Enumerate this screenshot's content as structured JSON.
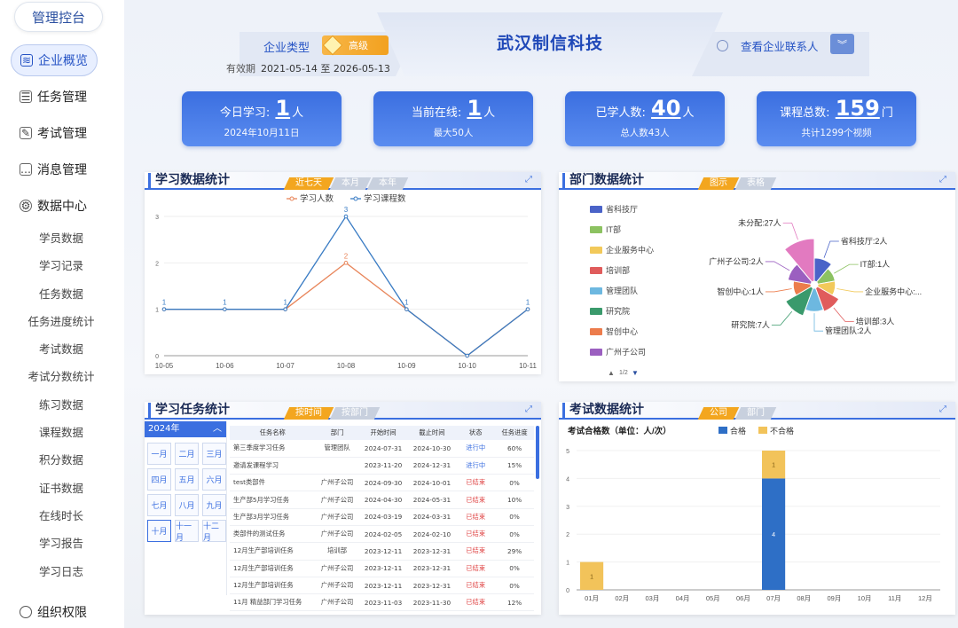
{
  "sidebar": {
    "logo": "管理控台",
    "main_items": [
      {
        "label": "企业概览",
        "icon": "layers-icon",
        "active": true
      },
      {
        "label": "任务管理",
        "icon": "task-icon",
        "active": false
      },
      {
        "label": "考试管理",
        "icon": "exam-icon",
        "active": false
      },
      {
        "label": "消息管理",
        "icon": "message-icon",
        "active": false
      },
      {
        "label": "数据中心",
        "icon": "gear-icon",
        "active": false
      }
    ],
    "sub_items": [
      "学员数据",
      "学习记录",
      "任务数据",
      "任务进度统计",
      "考试数据",
      "考试分数统计",
      "练习数据",
      "课程数据",
      "积分数据",
      "证书数据",
      "在线时长",
      "学习报告",
      "学习日志"
    ],
    "bottom_item": "组织权限"
  },
  "header": {
    "enterprise_type_label": "企业类型",
    "enterprise_level": "高级",
    "validity_label": "有效期",
    "validity_value": "2021-05-14 至 2026-05-13",
    "company_name": "武汉制信科技",
    "contact_label": "查看企业联系人"
  },
  "stats": [
    {
      "label": "今日学习:",
      "value": "1",
      "unit": "人",
      "sub": "2024年10月11日"
    },
    {
      "label": "当前在线:",
      "value": "1",
      "unit": "人",
      "sub": "最大50人"
    },
    {
      "label": "已学人数:",
      "value": "40",
      "unit": "人",
      "sub": "总人数43人"
    },
    {
      "label": "课程总数:",
      "value": "159",
      "unit": "门",
      "sub": "共计1299个视频"
    }
  ],
  "study_panel": {
    "title": "学习数据统计",
    "tabs": [
      "近七天",
      "本月",
      "本年"
    ],
    "active_tab": 0
  },
  "dept_panel": {
    "title": "部门数据统计",
    "tabs": [
      "图示",
      "表格"
    ],
    "active_tab": 0,
    "legend_pager": "1/2"
  },
  "task_panel": {
    "title": "学习任务统计",
    "tabs": [
      "按时间",
      "按部门"
    ],
    "active_tab": 0,
    "calendar_year": "2024年",
    "months": [
      "一月",
      "二月",
      "三月",
      "四月",
      "五月",
      "六月",
      "七月",
      "八月",
      "九月",
      "十月",
      "十一月",
      "十二月"
    ],
    "selected_month": 9,
    "columns": [
      "任务名称",
      "部门",
      "开始时间",
      "截止时间",
      "状态",
      "任务进度"
    ],
    "rows": [
      [
        "第三季度学习任务",
        "管理团队",
        "2024-07-31",
        "2024-10-30",
        "进行中",
        "60%"
      ],
      [
        "邀请发课程学习",
        "",
        "2023-11-20",
        "2024-12-31",
        "进行中",
        "15%"
      ],
      [
        "test类部件",
        "广州子公司",
        "2024-09-30",
        "2024-10-01",
        "已结束",
        "0%"
      ],
      [
        "生产部5月学习任务",
        "广州子公司",
        "2024-04-30",
        "2024-05-31",
        "已结束",
        "10%"
      ],
      [
        "生产部3月学习任务",
        "广州子公司",
        "2024-03-19",
        "2024-03-31",
        "已结束",
        "0%"
      ],
      [
        "类部件的测试任务",
        "广州子公司",
        "2024-02-05",
        "2024-02-10",
        "已结束",
        "0%"
      ],
      [
        "12月生产部培训任务",
        "培训部",
        "2023-12-11",
        "2023-12-31",
        "已结束",
        "29%"
      ],
      [
        "12月生产部培训任务",
        "广州子公司",
        "2023-12-11",
        "2023-12-31",
        "已结束",
        "0%"
      ],
      [
        "12月生产部培训任务",
        "广州子公司",
        "2023-12-11",
        "2023-12-31",
        "已结束",
        "0%"
      ],
      [
        "11月 精益部门学习任务",
        "广州子公司",
        "2023-11-03",
        "2023-11-30",
        "已结束",
        "12%"
      ]
    ]
  },
  "exam_panel": {
    "title": "考试数据统计",
    "tabs": [
      "公司",
      "部门"
    ],
    "active_tab": 0
  },
  "colors": {
    "accent": "#3b6fe0",
    "orange": "#f3a61f",
    "line_study": "#e8855a",
    "line_course": "#3a7cc4"
  },
  "chart_data": [
    {
      "type": "line",
      "x": [
        "10-05",
        "10-06",
        "10-07",
        "10-08",
        "10-09",
        "10-10",
        "10-11"
      ],
      "series": [
        {
          "name": "学习人数",
          "values": [
            1,
            1,
            1,
            2,
            1,
            0,
            1
          ],
          "color": "#e8855a"
        },
        {
          "name": "学习课程数",
          "values": [
            1,
            1,
            1,
            3,
            1,
            0,
            1
          ],
          "color": "#3a7cc4"
        }
      ],
      "ylim": [
        0,
        3
      ],
      "yticks": [
        "0",
        "1",
        "2",
        "3"
      ],
      "point_labels": [
        {
          "series": 0,
          "index": 3,
          "text": "2"
        },
        {
          "series": 1,
          "index": 0,
          "text": "1"
        },
        {
          "series": 1,
          "index": 1,
          "text": "1"
        },
        {
          "series": 1,
          "index": 2,
          "text": "1"
        },
        {
          "series": 1,
          "index": 3,
          "text": "3"
        },
        {
          "series": 1,
          "index": 4,
          "text": "1"
        },
        {
          "series": 1,
          "index": 6,
          "text": "1"
        }
      ],
      "legend_position": "top"
    },
    {
      "type": "pie",
      "rose": true,
      "slices": [
        {
          "name": "省科技厅",
          "label": "省科技厅:2人",
          "value": 2,
          "color": "#4a63c8"
        },
        {
          "name": "IT部",
          "label": "IT部:1人",
          "value": 1,
          "color": "#8cc261"
        },
        {
          "name": "企业服务中心",
          "label": "企业服务中心:...",
          "value": 1,
          "color": "#f2c95a"
        },
        {
          "name": "培训部",
          "label": "培训部:3人",
          "value": 3,
          "color": "#e05c5c"
        },
        {
          "name": "管理团队",
          "label": "管理团队:2人",
          "value": 2,
          "color": "#6db8e0"
        },
        {
          "name": "研究院",
          "label": "研究院:7人",
          "value": 7,
          "color": "#3a9a6c"
        },
        {
          "name": "智创中心",
          "label": "智创中心:1人",
          "value": 1,
          "color": "#ec7c4c"
        },
        {
          "name": "广州子公司",
          "label": "广州子公司:2人",
          "value": 2,
          "color": "#9b5fc0"
        },
        {
          "name": "未分配",
          "label": "未分配:27人",
          "value": 27,
          "color": "#e27ac0"
        }
      ],
      "legend_visible": [
        "省科技厅",
        "IT部",
        "企业服务中心",
        "培训部",
        "管理团队",
        "研究院",
        "智创中心",
        "广州子公司"
      ],
      "legend_position": "left"
    },
    {
      "type": "bar",
      "stacked": true,
      "title": "考试合格数（单位：人/次）",
      "categories": [
        "01月",
        "02月",
        "03月",
        "04月",
        "05月",
        "06月",
        "07月",
        "08月",
        "09月",
        "10月",
        "11月",
        "12月"
      ],
      "series": [
        {
          "name": "合格",
          "values": [
            0,
            0,
            0,
            0,
            0,
            0,
            4,
            0,
            0,
            0,
            0,
            0
          ],
          "color": "#2e6fc6"
        },
        {
          "name": "不合格",
          "values": [
            1,
            0,
            0,
            0,
            0,
            0,
            1,
            0,
            0,
            0,
            0,
            0
          ],
          "color": "#f2c35a"
        }
      ],
      "ylim": [
        0,
        5
      ],
      "yticks": [
        "0",
        "1",
        "2",
        "3",
        "4",
        "5"
      ],
      "legend_position": "top"
    }
  ]
}
